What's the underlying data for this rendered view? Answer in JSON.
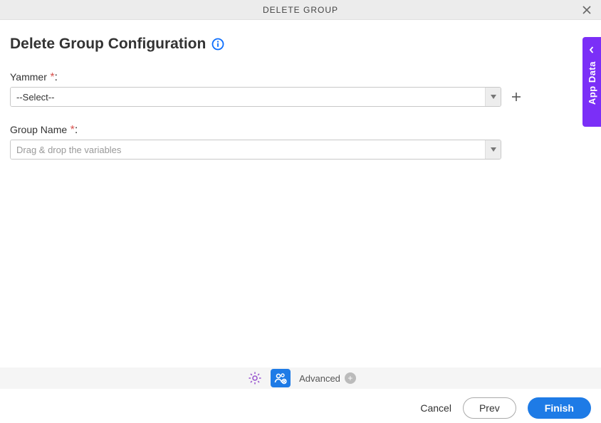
{
  "header": {
    "title": "DELETE GROUP"
  },
  "page": {
    "title": "Delete Group Configuration"
  },
  "form": {
    "yammer": {
      "label": "Yammer",
      "value": "--Select--"
    },
    "groupName": {
      "label": "Group Name",
      "placeholder": "Drag & drop the variables",
      "value": ""
    }
  },
  "sidePanel": {
    "label": "App Data"
  },
  "tabs": {
    "advancedLabel": "Advanced"
  },
  "footer": {
    "cancel": "Cancel",
    "prev": "Prev",
    "finish": "Finish"
  }
}
